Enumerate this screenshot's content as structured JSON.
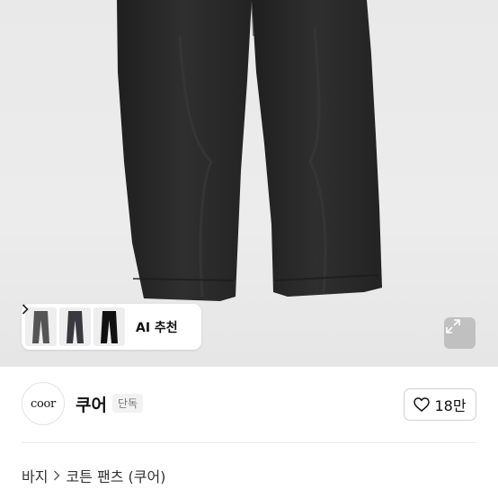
{
  "ai_recommend": {
    "label": "AI 추천",
    "thumbnails": [
      "grey-pants-thumb",
      "charcoal-pants-thumb",
      "black-pants-thumb"
    ]
  },
  "icons": {
    "expand": "expand-arrows-icon",
    "chevron": "chevron-right-icon",
    "heart": "heart-icon"
  },
  "seller": {
    "logo_text": "coor",
    "name": "쿠어",
    "badge": "단독"
  },
  "like": {
    "count": "18만"
  },
  "breadcrumb": {
    "category": "바지",
    "subcategory": "코튼 팬츠 (쿠어)"
  },
  "colors": {
    "pants": "#2b2b2b",
    "image_bg": "#e9e9e9",
    "text_primary": "#111111",
    "badge_bg": "#f2f2f2"
  }
}
